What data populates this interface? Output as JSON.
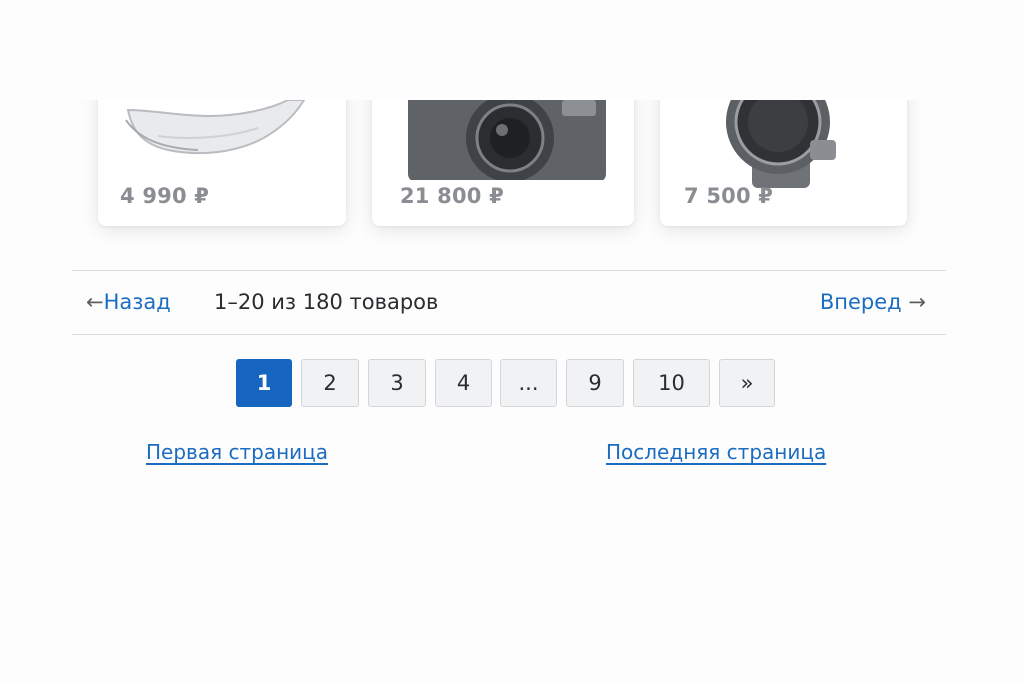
{
  "products": [
    {
      "price": "4 990 ₽",
      "icon": "sneaker-icon"
    },
    {
      "price": "21 800 ₽",
      "icon": "camera-icon"
    },
    {
      "price": "7 500 ₽",
      "icon": "watch-icon"
    }
  ],
  "nav": {
    "prev_arrow": "←",
    "prev_label": "Назад",
    "range": "1–20",
    "total": "из 180 товаров",
    "next_label": "Вперед",
    "next_arrow": "→"
  },
  "pagination": {
    "pages": [
      "1",
      "2",
      "3",
      "4",
      "...",
      "9",
      "10"
    ],
    "next_symbol": "»",
    "current": "1"
  },
  "links": {
    "first_page": "Первая страница",
    "last_page": "Последняя страница"
  },
  "colors": {
    "accent": "#1665c0",
    "link": "#1c6dc1"
  }
}
